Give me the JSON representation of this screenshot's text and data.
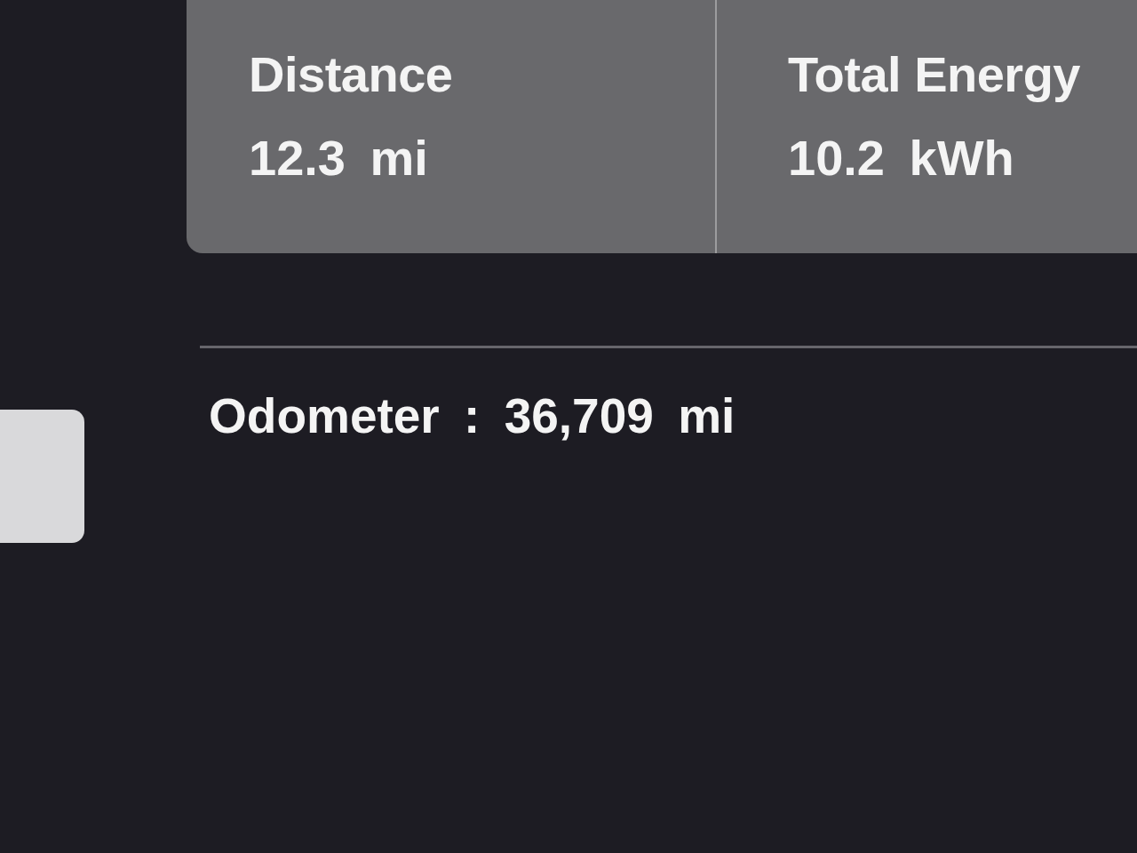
{
  "trip_card": {
    "stats": [
      {
        "label": "Distance",
        "value": "12.3 mi"
      },
      {
        "label": "Total Energy",
        "value": "10.2 kWh"
      }
    ]
  },
  "odometer": "Odometer : 36,709 mi"
}
